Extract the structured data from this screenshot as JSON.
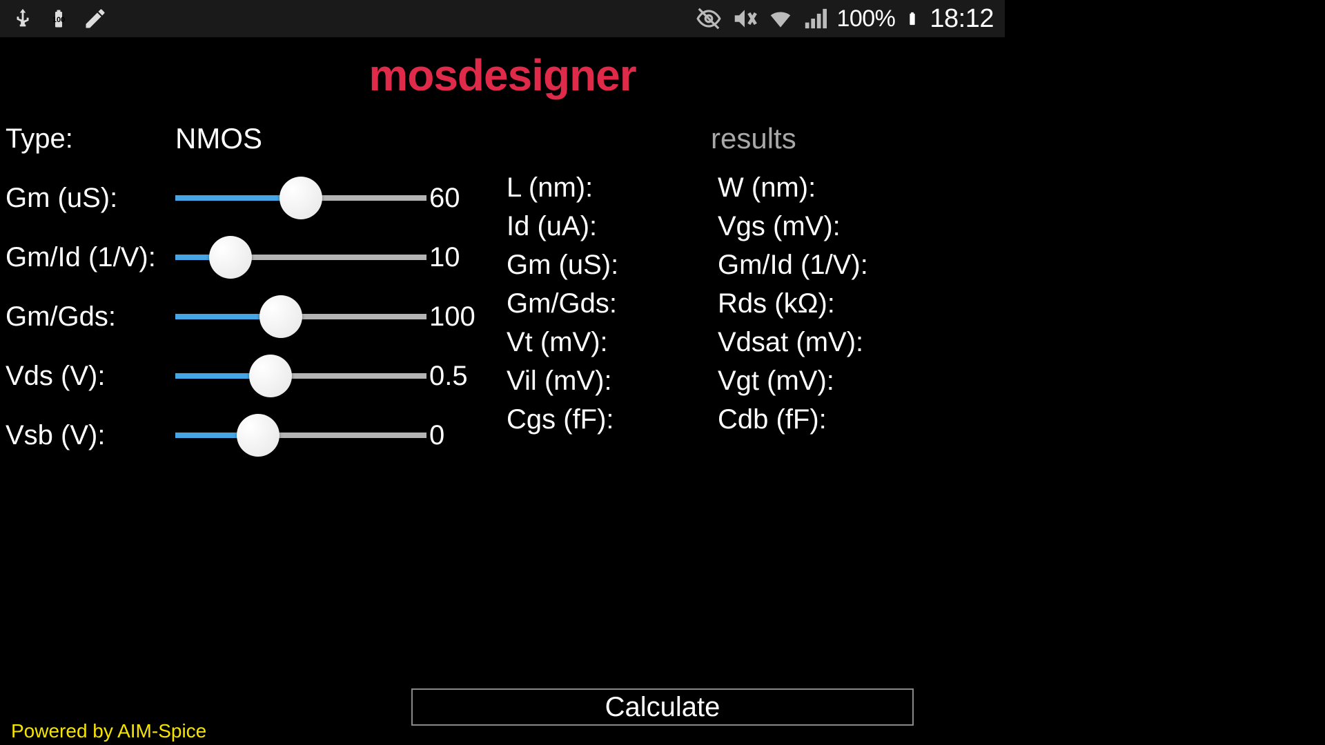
{
  "status": {
    "battery_pct": "100%",
    "time": "18:12",
    "small_battery_text": "100"
  },
  "app": {
    "title": "mosdesigner",
    "credit": "Powered by AIM-Spice",
    "calculate_label": "Calculate"
  },
  "type": {
    "label": "Type:",
    "value": "NMOS"
  },
  "sliders": {
    "gm": {
      "label": "Gm (uS):",
      "value": "60",
      "fill_pct": 50
    },
    "gmid": {
      "label": "Gm/Id (1/V):",
      "value": "10",
      "fill_pct": 22
    },
    "gmgds": {
      "label": "Gm/Gds:",
      "value": "100",
      "fill_pct": 42
    },
    "vds": {
      "label": "Vds (V):",
      "value": "0.5",
      "fill_pct": 38
    },
    "vsb": {
      "label": "Vsb (V):",
      "value": "0",
      "fill_pct": 33
    }
  },
  "results": {
    "header": "results",
    "l": "L (nm):",
    "w": "W (nm):",
    "idua": "Id (uA):",
    "vgs": "Vgs (mV):",
    "gm": "Gm (uS):",
    "gmid": "Gm/Id (1/V):",
    "gmgds": "Gm/Gds:",
    "rds": "Rds (kΩ):",
    "vt": "Vt (mV):",
    "vdsat": "Vdsat (mV):",
    "vil": "Vil (mV):",
    "vgt": "Vgt (mV):",
    "cgs": "Cgs (fF):",
    "cdb": "Cdb (fF):"
  }
}
